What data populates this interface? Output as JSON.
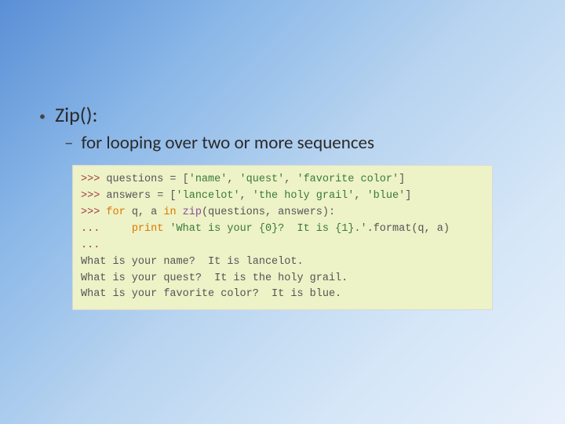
{
  "slide": {
    "bullet1": "Zip():",
    "bullet2": "for looping over two or more sequences"
  },
  "code": {
    "l1": {
      "prompt": ">>>",
      "rest": " questions = [",
      "s1": "'name'",
      "c1": ", ",
      "s2": "'quest'",
      "c2": ", ",
      "s3": "'favorite color'",
      "end": "]"
    },
    "l2": {
      "prompt": ">>>",
      "rest": " answers = [",
      "s1": "'lancelot'",
      "c1": ", ",
      "s2": "'the holy grail'",
      "c2": ", ",
      "s3": "'blue'",
      "end": "]"
    },
    "l3": {
      "prompt": ">>>",
      "sp": " ",
      "kw1": "for",
      "mid1": " q, a ",
      "kw2": "in",
      "sp2": " ",
      "fn": "zip",
      "rest": "(questions, answers):"
    },
    "l4": {
      "cont": "...",
      "pad": "     ",
      "kw": "print",
      "sp": " ",
      "str": "'What is your {0}?  It is {1}.'",
      "rest": ".format(q, a)"
    },
    "l5": {
      "cont": "..."
    },
    "l6": "What is your name?  It is lancelot.",
    "l7": "What is your quest?  It is the holy grail.",
    "l8": "What is your favorite color?  It is blue."
  }
}
